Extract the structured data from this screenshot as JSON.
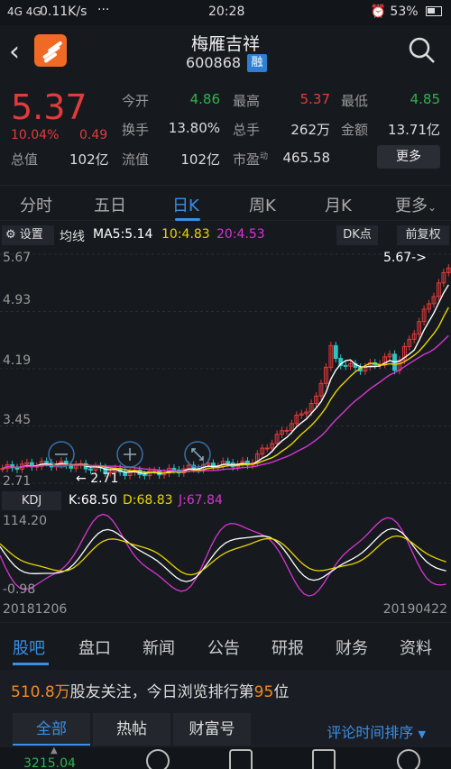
{
  "status": {
    "signal": "4G 4G",
    "speed": "0.11K/s",
    "dots": "···",
    "time": "20:28",
    "battery": "53%"
  },
  "header": {
    "name": "梅雁吉祥",
    "code": "600868",
    "rong": "融"
  },
  "quote": {
    "price": "5.37",
    "pct": "10.04%",
    "change": "0.49",
    "total_label": "总值",
    "total_value": "102亿",
    "grid": [
      {
        "label": "今开",
        "value": "4.86",
        "color": "#2fb34d"
      },
      {
        "label": "最高",
        "value": "5.37",
        "color": "#e23b3b"
      },
      {
        "label": "最低",
        "value": "4.85",
        "color": "#2fb34d"
      },
      {
        "label": "换手",
        "value": "13.80%",
        "color": "#dddddd"
      },
      {
        "label": "总手",
        "value": "262万",
        "color": "#dddddd"
      },
      {
        "label": "金额",
        "value": "13.71亿",
        "color": "#dddddd"
      },
      {
        "label": "流值",
        "value": "102亿",
        "color": "#dddddd"
      },
      {
        "label": "市盈",
        "value": "465.58",
        "color": "#dddddd",
        "sup": "动"
      }
    ],
    "more": "更多"
  },
  "tabs": [
    "分时",
    "五日",
    "日K",
    "周K",
    "月K",
    "更多"
  ],
  "ma": {
    "settings": "设置",
    "title": "均线",
    "ma5": "MA5:5.14",
    "ma10": "10:4.83",
    "ma20": "20:4.53",
    "dk": "DK点",
    "fq": "前复权"
  },
  "chart_data": {
    "type": "candlestick",
    "y_ticks": [
      "5.67",
      "4.93",
      "4.19",
      "3.45",
      "2.71"
    ],
    "ylim": [
      2.71,
      5.67
    ],
    "max_label": "5.67->",
    "min_label": "2.71",
    "ma_legend": [
      {
        "name": "MA5",
        "value": "5.14",
        "color": "#ffffff"
      },
      {
        "name": "10",
        "value": "4.83",
        "color": "#e8d400"
      },
      {
        "name": "20",
        "value": "4.53",
        "color": "#d635d0"
      }
    ],
    "kdj": {
      "label": "KDJ",
      "k": "K:68.50",
      "d": "D:68.83",
      "j": "J:67.84",
      "y_ticks": [
        "114.20",
        "-0.98"
      ]
    },
    "x_start": "20181206",
    "x_end": "20190422"
  },
  "sub_tabs": [
    "股吧",
    "盘口",
    "新闻",
    "公告",
    "研报",
    "财务",
    "资料"
  ],
  "follow": {
    "count": "510.8万",
    "text1": "股友关注，今日浏览排行第",
    "rank": "95",
    "text2": "位"
  },
  "categories": [
    "全部",
    "热帖",
    "财富号"
  ],
  "sort_label": "评论时间排序",
  "bottom": {
    "index_value": "3215.04"
  },
  "colors": {
    "up": "#e23b3b",
    "down": "#2fb34d",
    "accent": "#3a8ee6"
  }
}
